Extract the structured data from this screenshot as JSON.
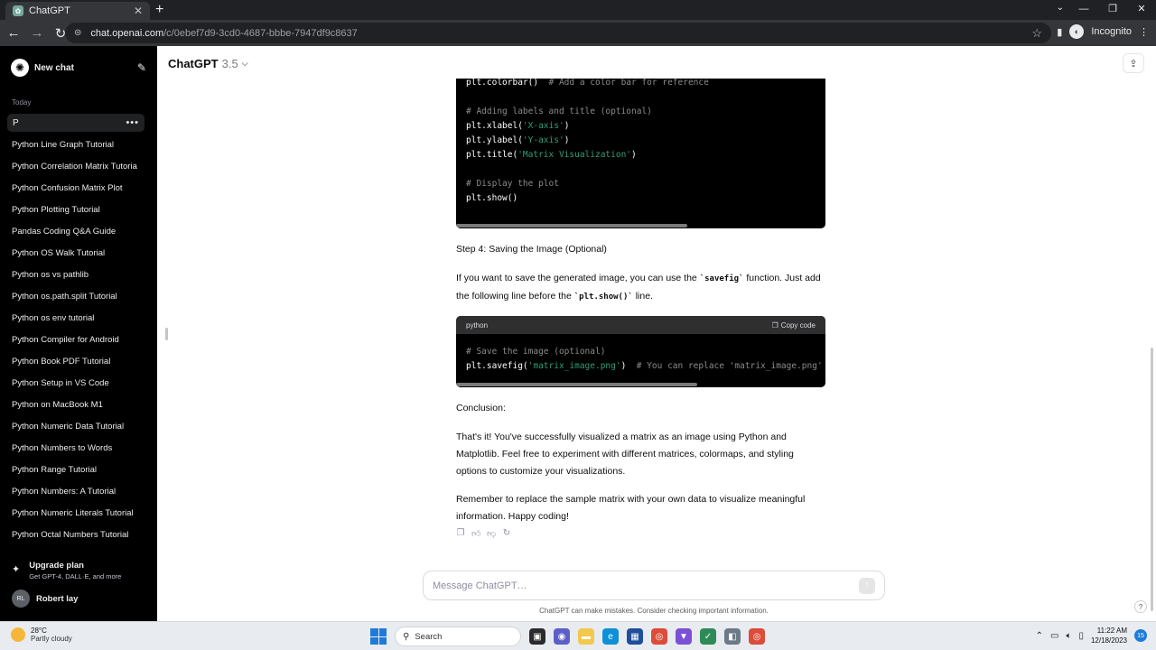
{
  "browser": {
    "tab_title": "ChatGPT",
    "url_host": "chat.openai.com",
    "url_path": "/c/0ebef7d9-3cd0-4687-bbbe-7947df9c8637",
    "profile_label": "Incognito"
  },
  "sidebar": {
    "new_chat_label": "New chat",
    "section_label": "Today",
    "active_item": "P",
    "items": [
      "Python Line Graph Tutorial",
      "Python Correlation Matrix Tutoria",
      "Python Confusion Matrix Plot",
      "Python Plotting Tutorial",
      "Pandas Coding Q&A Guide",
      "Python OS Walk Tutorial",
      "Python os vs pathlib",
      "Python os.path.split Tutorial",
      "Python os env tutorial",
      "Python Compiler for Android",
      "Python Book PDF Tutorial",
      "Python Setup in VS Code",
      "Python on MacBook M1",
      "Python Numeric Data Tutorial",
      "Python Numbers to Words",
      "Python Range Tutorial",
      "Python Numbers: A Tutorial",
      "Python Numeric Literals Tutorial",
      "Python Octal Numbers Tutorial"
    ],
    "upgrade_title": "Upgrade plan",
    "upgrade_subtitle": "Get GPT-4, DALL·E, and more",
    "user_initials": "RL",
    "user_name": "Robert lay"
  },
  "header": {
    "model_name": "ChatGPT",
    "model_version": "3.5"
  },
  "code_block_1": {
    "lines": [
      {
        "code": "plt.colorbar()",
        "comment": "  # Add a color bar for reference"
      },
      {
        "code": "",
        "comment": ""
      },
      {
        "code": "",
        "comment": "# Adding labels and title (optional)"
      },
      {
        "code": "plt.xlabel(",
        "string": "'X-axis'",
        "tail": ")"
      },
      {
        "code": "plt.ylabel(",
        "string": "'Y-axis'",
        "tail": ")"
      },
      {
        "code": "plt.title(",
        "string": "'Matrix Visualization'",
        "tail": ")"
      },
      {
        "code": "",
        "comment": ""
      },
      {
        "code": "",
        "comment": "# Display the plot"
      },
      {
        "code": "plt.show()",
        "comment": ""
      }
    ]
  },
  "content": {
    "step4_heading": "Step 4: Saving the Image (Optional)",
    "save_text_1": "If you want to save the generated image, you can use the ",
    "save_code_1": "`savefig`",
    "save_text_2": " function. Just add the following line before the ",
    "save_code_2": "`plt.show()`",
    "save_text_3": " line.",
    "conclusion_heading": "Conclusion:",
    "conclusion_text": "That's it! You've successfully visualized a matrix as an image using Python and Matplotlib. Feel free to experiment with different matrices, colormaps, and styling options to customize your visualizations.",
    "remember_text": "Remember to replace the sample matrix with your own data to visualize meaningful information. Happy coding!"
  },
  "code_block_2": {
    "language": "python",
    "copy_label": "Copy code",
    "line1_comment": "# Save the image (optional)",
    "line2_code": "plt.savefig(",
    "line2_string": "'matrix_image.png'",
    "line2_tail": ")",
    "line2_comment": "  # You can replace 'matrix_image.png' w"
  },
  "composer": {
    "placeholder": "Message ChatGPT…",
    "disclaimer": "ChatGPT can make mistakes. Consider checking important information."
  },
  "taskbar": {
    "weather_temp": "28°C",
    "weather_desc": "Partly cloudy",
    "search_placeholder": "Search",
    "time": "11:22 AM",
    "date": "12/18/2023",
    "notification_count": "15"
  }
}
